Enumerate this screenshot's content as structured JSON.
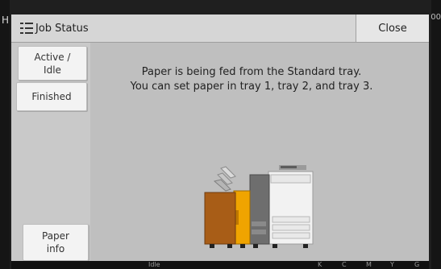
{
  "window": {
    "title": "Job Status",
    "close_label": "Close"
  },
  "sidebar": {
    "active_label": "Active /\nIdle",
    "finished_label": "Finished",
    "paper_label": "Paper\ninfo"
  },
  "main": {
    "message_line1": "Paper is being fed from the Standard tray.",
    "message_line2": "You can set paper in tray 1, tray 2, and tray 3."
  },
  "status": {
    "state": "Idle",
    "left_edge_letter": "H",
    "right_edge_text": "00",
    "ink_labels": [
      "K",
      "C",
      "M",
      "Y",
      "G"
    ]
  },
  "colors": {
    "accent": "#f0a400",
    "panel_bg": "#bfbfbf",
    "header_bg": "#d6d6d6"
  }
}
